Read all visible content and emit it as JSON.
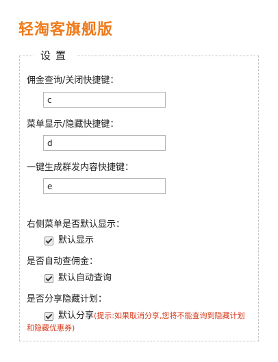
{
  "app": {
    "title": "轻淘客旗舰版"
  },
  "settings": {
    "legend": "设置",
    "commission_hotkey": {
      "label": "佣金查询/关闭快捷键：",
      "value": "c"
    },
    "menu_hotkey": {
      "label": "菜单显示/隐藏快捷键：",
      "value": "d"
    },
    "group_content_hotkey": {
      "label": "一键生成群发内容快捷键：",
      "value": "e"
    },
    "right_menu_default": {
      "label": "右侧菜单是否默认显示：",
      "option_label": "默认显示",
      "checked": true
    },
    "auto_commission": {
      "label": "是否自动查佣金：",
      "option_label": "默认自动查询",
      "checked": true
    },
    "share_hide_plan": {
      "label": "是否分享隐藏计划：",
      "option_label": "默认分享",
      "checked": true,
      "hint_line1": "(提示:如果取消分享,您将不能查询到隐藏计划",
      "hint_line2": "和隐藏优惠券)"
    }
  }
}
